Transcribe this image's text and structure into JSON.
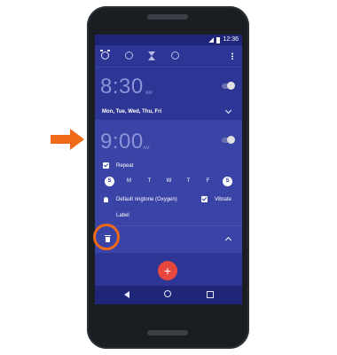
{
  "status_bar": {
    "time": "12:36"
  },
  "toolbar": {
    "tabs": [
      {
        "icon": "alarm-icon"
      },
      {
        "icon": "clock-icon"
      },
      {
        "icon": "timer-icon"
      },
      {
        "icon": "stopwatch-icon"
      }
    ],
    "menu_icon": "more-vert-icon"
  },
  "alarms": [
    {
      "time": "8:30",
      "ampm": "AM",
      "days": "Mon, Tue, Wed, Thu, Fri",
      "enabled": false
    },
    {
      "time": "9:00",
      "ampm": "AM",
      "enabled": false,
      "expanded": true,
      "repeat_label": "Repeat",
      "day_letters": [
        "S",
        "M",
        "T",
        "W",
        "T",
        "F",
        "S"
      ],
      "ringtone": "Default ringtone (Oxygen)",
      "vibrate_label": "Vibrate",
      "label_label": "Label"
    }
  ],
  "fab": {
    "label": "+"
  },
  "colors": {
    "accent": "#f06a1a",
    "primary": "#2d3595",
    "fab": "#e8473d"
  }
}
